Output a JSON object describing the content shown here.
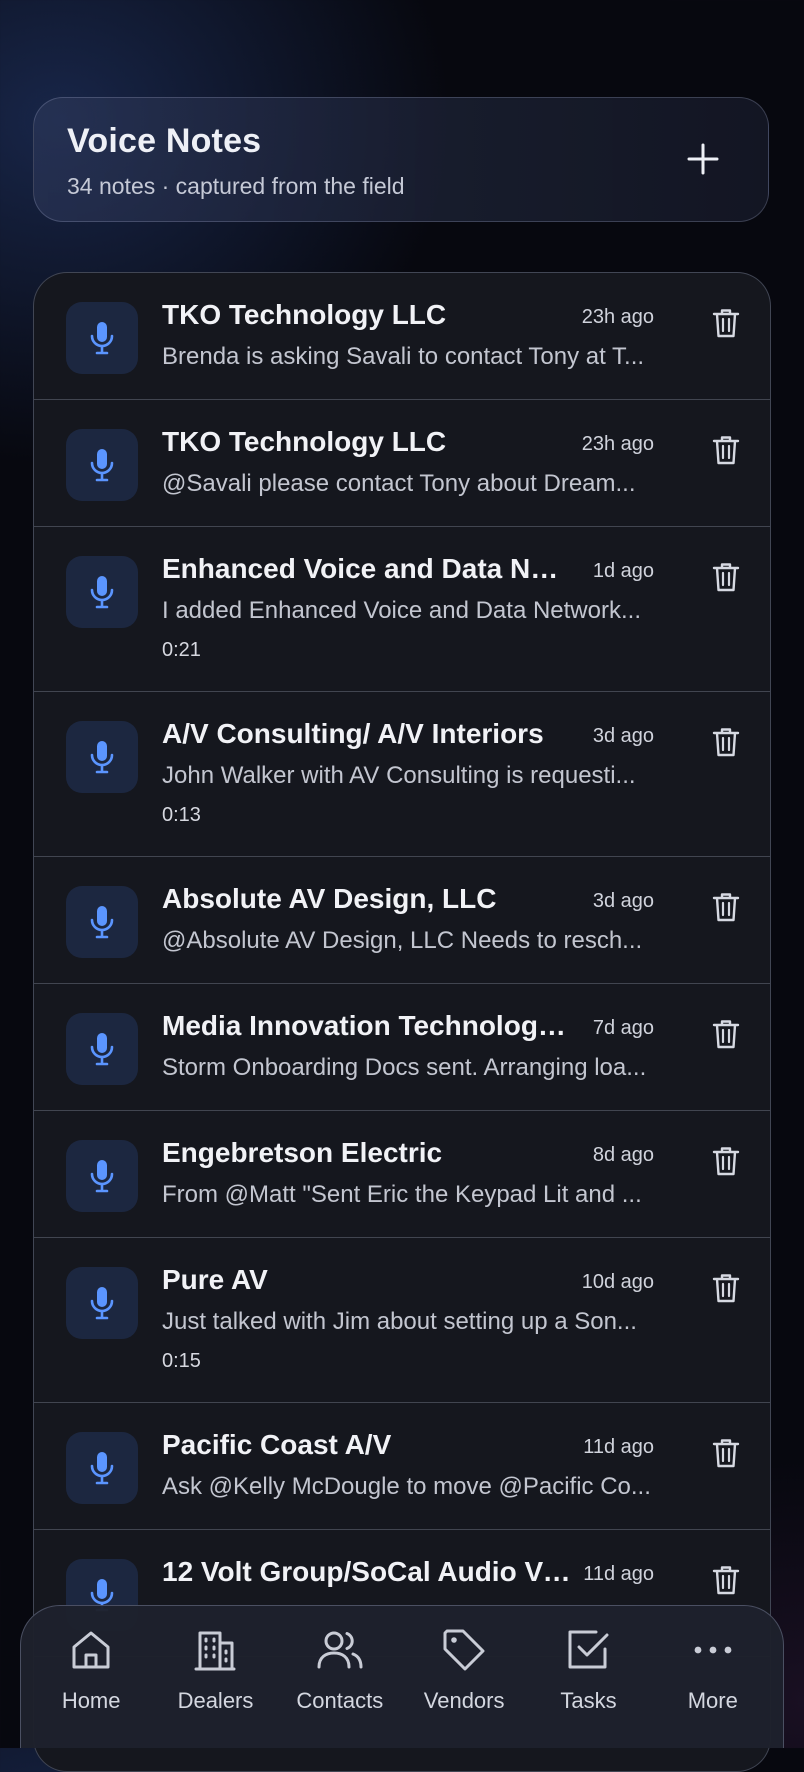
{
  "header": {
    "title": "Voice Notes",
    "subtitle": "34 notes · captured from the field",
    "add_icon": "plus-icon"
  },
  "notes": [
    {
      "title": "TKO Technology LLC",
      "time": "23h ago",
      "preview": "Brenda is asking Savali to contact Tony at T...",
      "duration": ""
    },
    {
      "title": "TKO Technology LLC",
      "time": "23h ago",
      "preview": "@Savali please contact Tony about Dream...",
      "duration": ""
    },
    {
      "title": "Enhanced Voice and Data Net...",
      "time": "1d ago",
      "preview": "I added Enhanced Voice and Data Network...",
      "duration": "0:21"
    },
    {
      "title": "A/V Consulting/ A/V Interiors",
      "time": "3d ago",
      "preview": "John Walker with AV Consulting is requesti...",
      "duration": "0:13"
    },
    {
      "title": "Absolute AV Design, LLC",
      "time": "3d ago",
      "preview": "@Absolute AV Design, LLC Needs to resch...",
      "duration": ""
    },
    {
      "title": "Media Innovation Technologies",
      "time": "7d ago",
      "preview": "Storm Onboarding Docs sent. Arranging loa...",
      "duration": ""
    },
    {
      "title": "Engebretson Electric",
      "time": "8d ago",
      "preview": "From @Matt \"Sent Eric the Keypad Lit and ...",
      "duration": ""
    },
    {
      "title": "Pure AV",
      "time": "10d ago",
      "preview": "Just talked with Jim about setting up a Son...",
      "duration": "0:15"
    },
    {
      "title": "Pacific Coast A/V",
      "time": "11d ago",
      "preview": "Ask @Kelly McDougle to move @Pacific Co...",
      "duration": ""
    },
    {
      "title": "12 Volt Group/SoCal Audio Vi...",
      "time": "11d ago",
      "preview": "",
      "duration": ""
    }
  ],
  "nav": {
    "items": [
      {
        "label": "Home",
        "icon": "home-icon"
      },
      {
        "label": "Dealers",
        "icon": "building-icon"
      },
      {
        "label": "Contacts",
        "icon": "users-icon"
      },
      {
        "label": "Vendors",
        "icon": "tag-icon"
      },
      {
        "label": "Tasks",
        "icon": "checkbox-icon"
      },
      {
        "label": "More",
        "icon": "more-icon"
      }
    ]
  },
  "colors": {
    "accent": "#5b95ff",
    "background": "#07080f",
    "card": "#15171e",
    "mic_box": "#1c2740"
  }
}
